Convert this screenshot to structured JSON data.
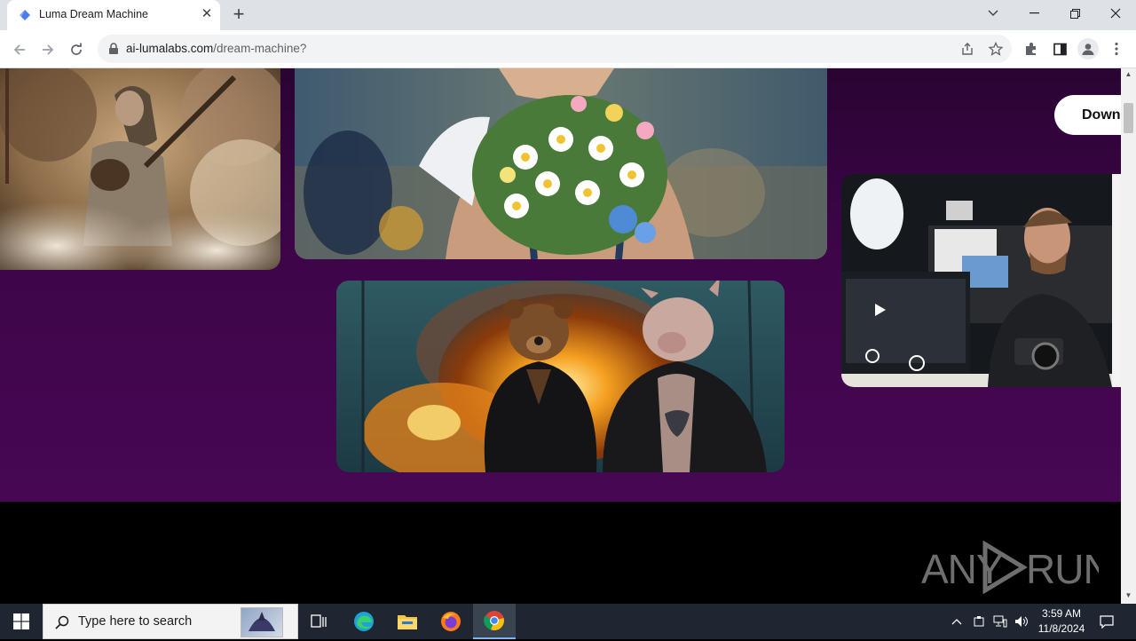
{
  "browser": {
    "tab_title": "Luma Dream Machine",
    "url_domain": "ai-lumalabs.com",
    "url_path": "/dream-machine?",
    "new_tab_label": "+",
    "close_tab_label": "✕"
  },
  "page": {
    "download_label": "Down",
    "watermark_text": "ANY RUN",
    "background_color": "#3d0548",
    "cards": [
      {
        "name": "musician-in-dust",
        "description": "Man playing a stringed instrument amid dust clouds"
      },
      {
        "name": "girl-with-flowers",
        "description": "Woman holding a bouquet of wildflowers"
      },
      {
        "name": "photographer-studio",
        "description": "Man with camera in a studio"
      },
      {
        "name": "bear-and-pig",
        "description": "Bear and pig in leather jackets before an explosion"
      }
    ]
  },
  "taskbar": {
    "search_placeholder": "Type here to search",
    "time": "3:59 AM",
    "date": "11/8/2024",
    "apps": [
      "task-view",
      "edge",
      "file-explorer",
      "firefox",
      "chrome"
    ]
  }
}
